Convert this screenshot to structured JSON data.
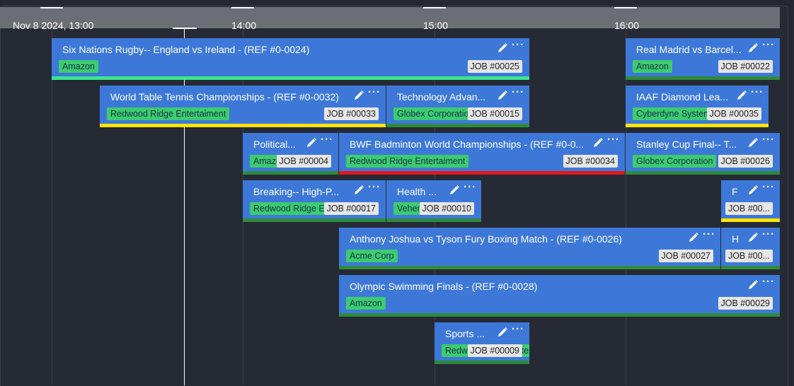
{
  "timeline": {
    "labels": [
      "Nov 8 2024, 13:00",
      "14:00",
      "15:00",
      "16:00"
    ]
  },
  "colors": {
    "green": "#2e8b3b",
    "mint": "#3ce68c",
    "yellow": "#ffe40a",
    "red": "#e3171c",
    "card": "#3d78d8",
    "tag": "#3ccb6f"
  },
  "jobs": [
    {
      "title": "Six Nations Rugby-- England vs Ireland - (REF #0-0024)",
      "client": "Amazon",
      "code": "JOB #00025",
      "status": "mint"
    },
    {
      "title": "Real Madrid vs Barcel...",
      "client": "Amazon",
      "code": "JOB #00022",
      "status": "green"
    },
    {
      "title": "World Table Tennis Championships - (REF #0-0032)",
      "client": "Redwood Ridge Entertaiment",
      "code": "JOB #00033",
      "status": "yellow"
    },
    {
      "title": "Technology Advan...",
      "client": "Globex Corporation",
      "code": "JOB #00015",
      "status": "green"
    },
    {
      "title": "IAAF Diamond Lea...",
      "client": "Cyberdyne Systems",
      "code": "JOB #00035",
      "status": "yellow"
    },
    {
      "title": "Political...",
      "client": "Amazon",
      "code": "JOB #00004",
      "status": "green"
    },
    {
      "title": "BWF Badminton World Championships - (REF #0-0...",
      "client": "Redwood Ridge Entertaiment",
      "code": "JOB #00034",
      "status": "red"
    },
    {
      "title": "Stanley Cup Final-- T...",
      "client": "Globex Corporation",
      "code": "JOB #00026",
      "status": "green"
    },
    {
      "title": "Breaking-- High-P...",
      "client": "Redwood Ridge Entertaiment",
      "code": "JOB #00017",
      "status": "green"
    },
    {
      "title": "Health ...",
      "client": "Vehement",
      "code": "JOB #00010",
      "status": "green"
    },
    {
      "title": "F",
      "client": "",
      "code": "JOB #00...",
      "status": "yellow"
    },
    {
      "title": "Anthony Joshua vs Tyson Fury Boxing Match - (REF #0-0026)",
      "client": "Acme Corp",
      "code": "JOB #00027",
      "status": "green"
    },
    {
      "title": "H",
      "client": "",
      "code": "JOB #00...",
      "status": "green"
    },
    {
      "title": "Olympic Swimming Finals - (REF #0-0028)",
      "client": "Amazon",
      "code": "JOB #00029",
      "status": "green"
    },
    {
      "title": "Sports ...",
      "client": "Redwood Ridge Entertaiment",
      "code": "JOB #00009",
      "status": "green"
    }
  ]
}
